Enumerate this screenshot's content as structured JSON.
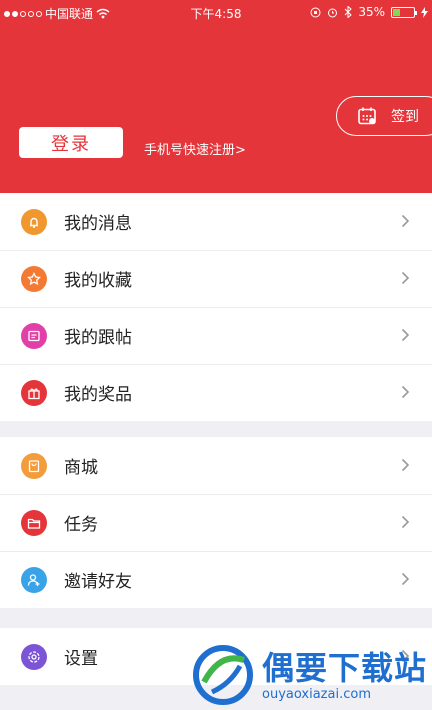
{
  "status_bar": {
    "carrier": "中国联通",
    "time": "下午4:58",
    "battery": "35%",
    "battery_level": 0.35
  },
  "header": {
    "login_label": "登录",
    "register_link": "手机号快速注册>",
    "signin_label": "签到",
    "bg_color": "#e3353a"
  },
  "groups": [
    {
      "items": [
        {
          "label": "我的消息",
          "icon": "bell-icon",
          "color": "#f0982f"
        },
        {
          "label": "我的收藏",
          "icon": "star-icon",
          "color": "#f47a34"
        },
        {
          "label": "我的跟帖",
          "icon": "comment-icon",
          "color": "#e040a8"
        },
        {
          "label": "我的奖品",
          "icon": "gift-icon",
          "color": "#e3353a"
        }
      ]
    },
    {
      "items": [
        {
          "label": "商城",
          "icon": "shop-icon",
          "color": "#f29c3c"
        },
        {
          "label": "任务",
          "icon": "folder-icon",
          "color": "#e3353a"
        },
        {
          "label": "邀请好友",
          "icon": "add-user-icon",
          "color": "#3aa3e8"
        }
      ]
    },
    {
      "items": [
        {
          "label": "设置",
          "icon": "settings-icon",
          "color": "#7b55d6"
        }
      ]
    }
  ],
  "watermark": {
    "title": "偶要下载站",
    "subtitle": "ouyaoxiazai.com"
  }
}
